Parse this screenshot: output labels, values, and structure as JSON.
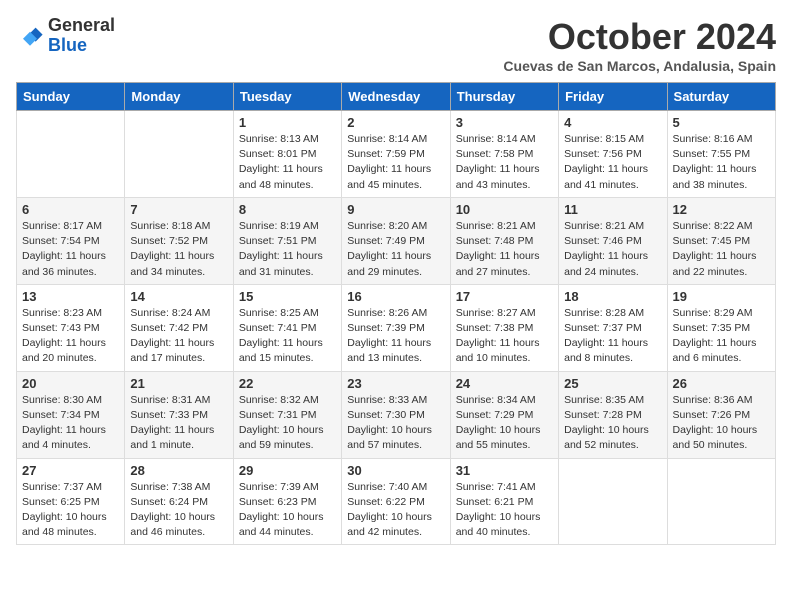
{
  "logo": {
    "general": "General",
    "blue": "Blue"
  },
  "title": "October 2024",
  "subtitle": "Cuevas de San Marcos, Andalusia, Spain",
  "days_of_week": [
    "Sunday",
    "Monday",
    "Tuesday",
    "Wednesday",
    "Thursday",
    "Friday",
    "Saturday"
  ],
  "weeks": [
    [
      {
        "day": "",
        "info": ""
      },
      {
        "day": "",
        "info": ""
      },
      {
        "day": "1",
        "info": "Sunrise: 8:13 AM\nSunset: 8:01 PM\nDaylight: 11 hours and 48 minutes."
      },
      {
        "day": "2",
        "info": "Sunrise: 8:14 AM\nSunset: 7:59 PM\nDaylight: 11 hours and 45 minutes."
      },
      {
        "day": "3",
        "info": "Sunrise: 8:14 AM\nSunset: 7:58 PM\nDaylight: 11 hours and 43 minutes."
      },
      {
        "day": "4",
        "info": "Sunrise: 8:15 AM\nSunset: 7:56 PM\nDaylight: 11 hours and 41 minutes."
      },
      {
        "day": "5",
        "info": "Sunrise: 8:16 AM\nSunset: 7:55 PM\nDaylight: 11 hours and 38 minutes."
      }
    ],
    [
      {
        "day": "6",
        "info": "Sunrise: 8:17 AM\nSunset: 7:54 PM\nDaylight: 11 hours and 36 minutes."
      },
      {
        "day": "7",
        "info": "Sunrise: 8:18 AM\nSunset: 7:52 PM\nDaylight: 11 hours and 34 minutes."
      },
      {
        "day": "8",
        "info": "Sunrise: 8:19 AM\nSunset: 7:51 PM\nDaylight: 11 hours and 31 minutes."
      },
      {
        "day": "9",
        "info": "Sunrise: 8:20 AM\nSunset: 7:49 PM\nDaylight: 11 hours and 29 minutes."
      },
      {
        "day": "10",
        "info": "Sunrise: 8:21 AM\nSunset: 7:48 PM\nDaylight: 11 hours and 27 minutes."
      },
      {
        "day": "11",
        "info": "Sunrise: 8:21 AM\nSunset: 7:46 PM\nDaylight: 11 hours and 24 minutes."
      },
      {
        "day": "12",
        "info": "Sunrise: 8:22 AM\nSunset: 7:45 PM\nDaylight: 11 hours and 22 minutes."
      }
    ],
    [
      {
        "day": "13",
        "info": "Sunrise: 8:23 AM\nSunset: 7:43 PM\nDaylight: 11 hours and 20 minutes."
      },
      {
        "day": "14",
        "info": "Sunrise: 8:24 AM\nSunset: 7:42 PM\nDaylight: 11 hours and 17 minutes."
      },
      {
        "day": "15",
        "info": "Sunrise: 8:25 AM\nSunset: 7:41 PM\nDaylight: 11 hours and 15 minutes."
      },
      {
        "day": "16",
        "info": "Sunrise: 8:26 AM\nSunset: 7:39 PM\nDaylight: 11 hours and 13 minutes."
      },
      {
        "day": "17",
        "info": "Sunrise: 8:27 AM\nSunset: 7:38 PM\nDaylight: 11 hours and 10 minutes."
      },
      {
        "day": "18",
        "info": "Sunrise: 8:28 AM\nSunset: 7:37 PM\nDaylight: 11 hours and 8 minutes."
      },
      {
        "day": "19",
        "info": "Sunrise: 8:29 AM\nSunset: 7:35 PM\nDaylight: 11 hours and 6 minutes."
      }
    ],
    [
      {
        "day": "20",
        "info": "Sunrise: 8:30 AM\nSunset: 7:34 PM\nDaylight: 11 hours and 4 minutes."
      },
      {
        "day": "21",
        "info": "Sunrise: 8:31 AM\nSunset: 7:33 PM\nDaylight: 11 hours and 1 minute."
      },
      {
        "day": "22",
        "info": "Sunrise: 8:32 AM\nSunset: 7:31 PM\nDaylight: 10 hours and 59 minutes."
      },
      {
        "day": "23",
        "info": "Sunrise: 8:33 AM\nSunset: 7:30 PM\nDaylight: 10 hours and 57 minutes."
      },
      {
        "day": "24",
        "info": "Sunrise: 8:34 AM\nSunset: 7:29 PM\nDaylight: 10 hours and 55 minutes."
      },
      {
        "day": "25",
        "info": "Sunrise: 8:35 AM\nSunset: 7:28 PM\nDaylight: 10 hours and 52 minutes."
      },
      {
        "day": "26",
        "info": "Sunrise: 8:36 AM\nSunset: 7:26 PM\nDaylight: 10 hours and 50 minutes."
      }
    ],
    [
      {
        "day": "27",
        "info": "Sunrise: 7:37 AM\nSunset: 6:25 PM\nDaylight: 10 hours and 48 minutes."
      },
      {
        "day": "28",
        "info": "Sunrise: 7:38 AM\nSunset: 6:24 PM\nDaylight: 10 hours and 46 minutes."
      },
      {
        "day": "29",
        "info": "Sunrise: 7:39 AM\nSunset: 6:23 PM\nDaylight: 10 hours and 44 minutes."
      },
      {
        "day": "30",
        "info": "Sunrise: 7:40 AM\nSunset: 6:22 PM\nDaylight: 10 hours and 42 minutes."
      },
      {
        "day": "31",
        "info": "Sunrise: 7:41 AM\nSunset: 6:21 PM\nDaylight: 10 hours and 40 minutes."
      },
      {
        "day": "",
        "info": ""
      },
      {
        "day": "",
        "info": ""
      }
    ]
  ]
}
